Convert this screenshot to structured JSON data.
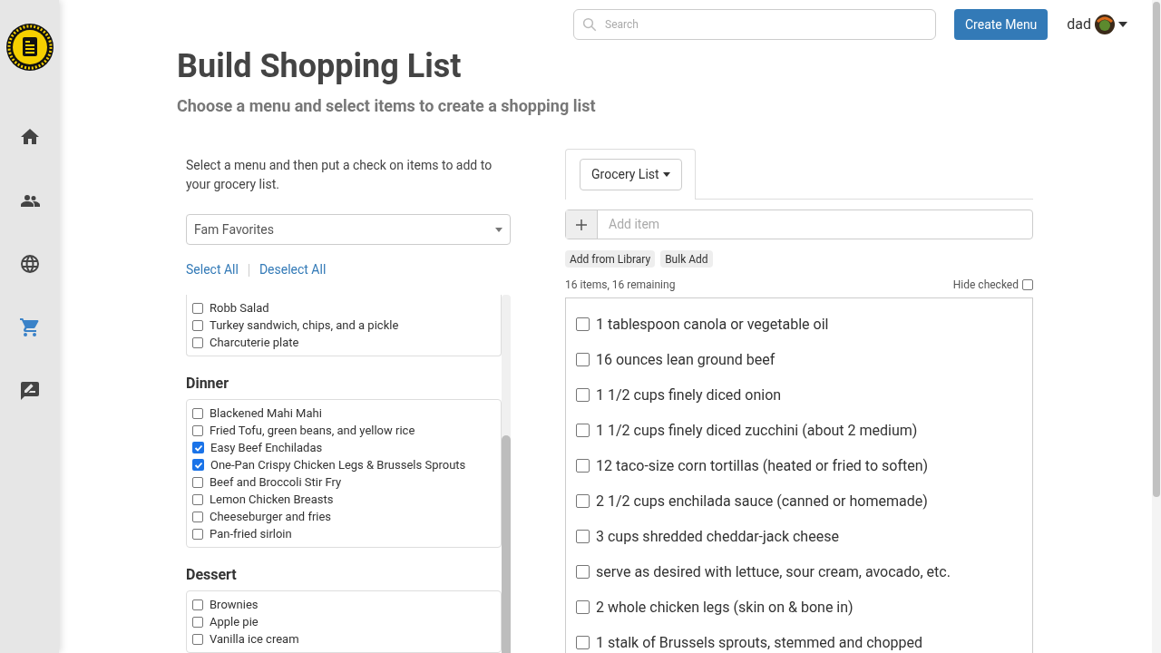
{
  "sidebar": {
    "items": [
      {
        "kind": "home",
        "selected": false
      },
      {
        "kind": "people",
        "selected": false
      },
      {
        "kind": "globe",
        "selected": false
      },
      {
        "kind": "cart",
        "selected": true
      },
      {
        "kind": "feedback",
        "selected": false
      }
    ]
  },
  "header": {
    "search": {
      "placeholder": "Search"
    },
    "create_button": "Create Menu",
    "user": "dad"
  },
  "title": "Build Shopping List",
  "subtitle": "Choose a menu and select items to create a shopping list",
  "left": {
    "instructions": "Select a menu and then put a check on items to add to your grocery list.",
    "menu_select": "Fam Favorites",
    "select_all": "Select All",
    "deselect_all": "Deselect All",
    "groups": [
      {
        "items": [
          {
            "label": "Robb Salad",
            "checked": false
          },
          {
            "label": "Turkey sandwich, chips, and a pickle",
            "checked": false
          },
          {
            "label": "Charcuterie plate",
            "checked": false
          }
        ]
      },
      {
        "title": "Dinner",
        "items": [
          {
            "label": "Blackened Mahi Mahi",
            "checked": false
          },
          {
            "label": "Fried Tofu, green beans, and yellow rice",
            "checked": false
          },
          {
            "label": "Easy Beef Enchiladas",
            "checked": true
          },
          {
            "label": "One-Pan Crispy Chicken Legs & Brussels Sprouts",
            "checked": true
          },
          {
            "label": "Beef and Broccoli Stir Fry",
            "checked": false
          },
          {
            "label": "Lemon Chicken Breasts",
            "checked": false
          },
          {
            "label": "Cheeseburger and fries",
            "checked": false
          },
          {
            "label": "Pan-fried sirloin",
            "checked": false
          }
        ]
      },
      {
        "title": "Dessert",
        "items": [
          {
            "label": "Brownies",
            "checked": false
          },
          {
            "label": "Apple pie",
            "checked": false
          },
          {
            "label": "Vanilla ice cream",
            "checked": false
          }
        ]
      }
    ]
  },
  "right": {
    "list_dropdown": "Grocery List",
    "add_item": {
      "placeholder": "Add item"
    },
    "actions": [
      "Add from Library",
      "Bulk Add"
    ],
    "summary": "16 items, 16 remaining",
    "hide_checked": {
      "label": "Hide checked",
      "checked": false
    },
    "items": [
      {
        "label": "1 tablespoon canola or vegetable oil",
        "checked": false
      },
      {
        "label": "16 ounces lean ground beef",
        "checked": false
      },
      {
        "label": "1 1/2 cups finely diced onion",
        "checked": false
      },
      {
        "label": "1 1/2 cups finely diced zucchini (about 2 medium)",
        "checked": false
      },
      {
        "label": "12 taco-size corn tortillas (heated or fried to soften)",
        "checked": false
      },
      {
        "label": "2 1/2 cups enchilada sauce (canned or homemade)",
        "checked": false
      },
      {
        "label": "3 cups shredded cheddar-jack cheese",
        "checked": false
      },
      {
        "label": "serve as desired with lettuce, sour cream, avocado, etc.",
        "checked": false
      },
      {
        "label": "2 whole chicken legs (skin on & bone in)",
        "checked": false
      },
      {
        "label": "1 stalk of Brussels sprouts, stemmed and chopped",
        "checked": false
      }
    ]
  }
}
